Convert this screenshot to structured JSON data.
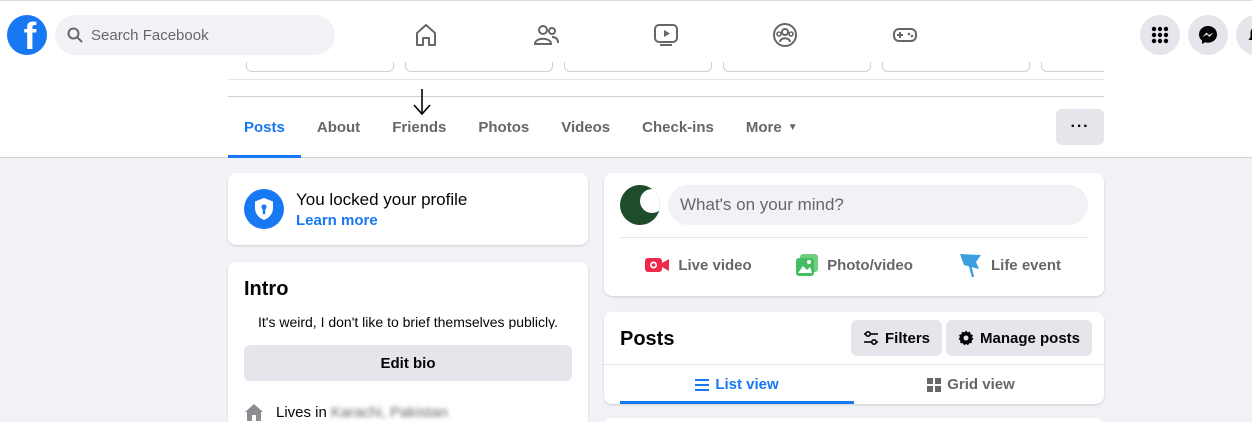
{
  "topbar": {
    "logo_letter": "f",
    "search_placeholder": "Search Facebook",
    "nav_icons": [
      "home-icon",
      "friends-icon",
      "watch-icon",
      "groups-icon",
      "gaming-icon"
    ],
    "right_buttons": [
      "menu-grid-icon",
      "messenger-icon",
      "notifications-icon"
    ]
  },
  "profile": {
    "tabs": [
      {
        "label": "Posts",
        "active": true
      },
      {
        "label": "About"
      },
      {
        "label": "Friends"
      },
      {
        "label": "Photos"
      },
      {
        "label": "Videos"
      },
      {
        "label": "Check-ins"
      },
      {
        "label": "More"
      }
    ],
    "more_options": "···"
  },
  "lock_notice": {
    "title": "You locked your profile",
    "link": "Learn more"
  },
  "intro": {
    "title": "Intro",
    "bio": "It's weird, I don't like to brief themselves publicly.",
    "edit_bio": "Edit bio",
    "lives_label": "Lives in",
    "lives_place": "Karachi, Pakistan"
  },
  "composer": {
    "placeholder": "What's on your mind?",
    "actions": [
      {
        "label": "Live video",
        "icon": "live-video-icon",
        "color": "#f02849"
      },
      {
        "label": "Photo/video",
        "icon": "photo-icon",
        "color": "#45bd62"
      },
      {
        "label": "Life event",
        "icon": "flag-icon",
        "color": "#3b9ede"
      }
    ]
  },
  "posts": {
    "title": "Posts",
    "filters": "Filters",
    "manage": "Manage posts",
    "list_view": "List view",
    "grid_view": "Grid view"
  },
  "colors": {
    "accent": "#1877f2",
    "background": "#f0f2f5",
    "secondary_text": "#65676b"
  }
}
